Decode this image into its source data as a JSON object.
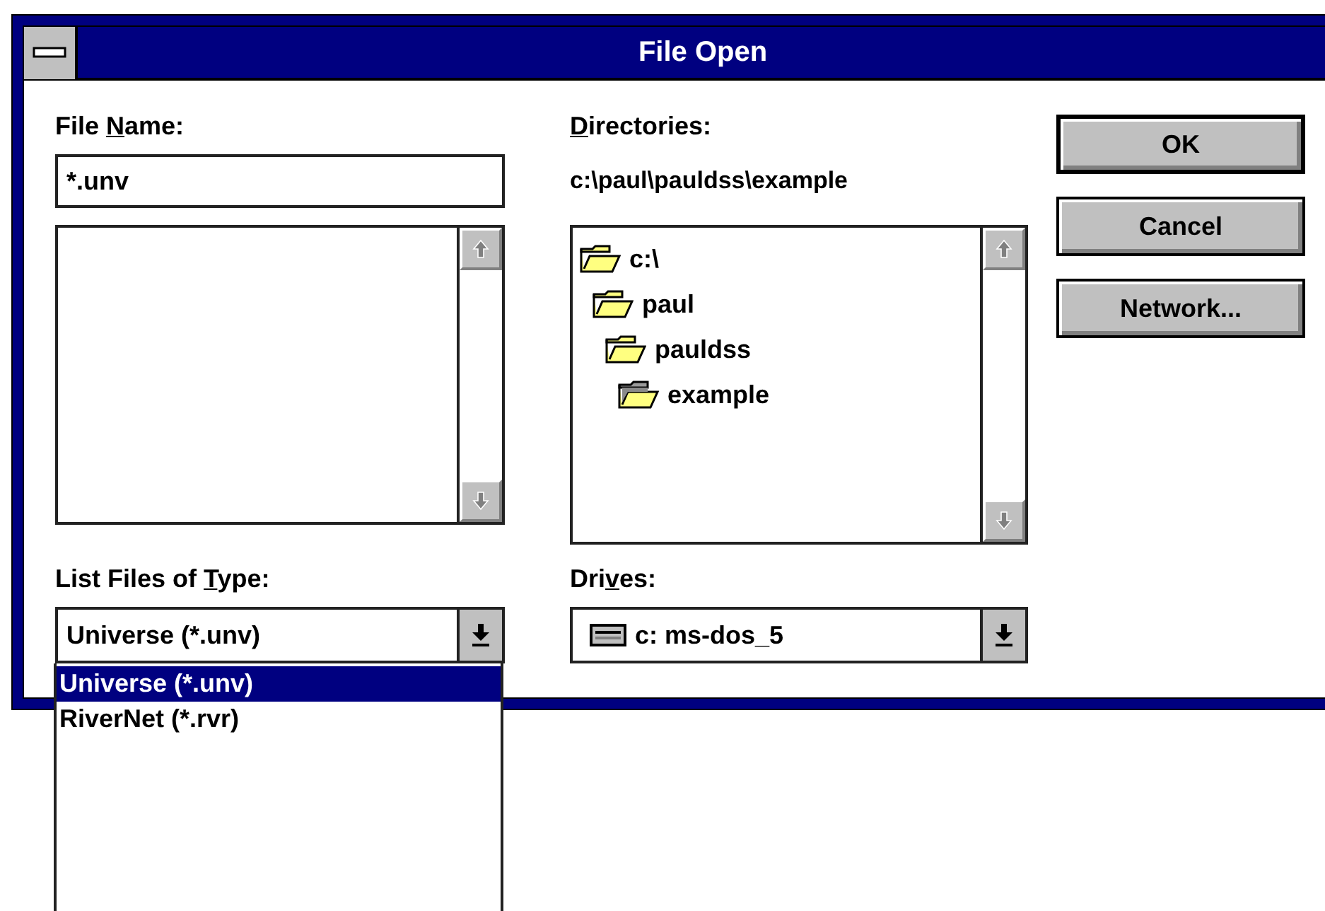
{
  "window": {
    "title": "File Open"
  },
  "file_name": {
    "label": [
      {
        "text": "File ",
        "underline": false
      },
      {
        "text": "N",
        "underline": true
      },
      {
        "text": "ame:",
        "underline": false
      }
    ],
    "value": "*.unv"
  },
  "type_filter": {
    "label": [
      {
        "text": "List Files of ",
        "underline": false
      },
      {
        "text": "T",
        "underline": true
      },
      {
        "text": "ype:",
        "underline": false
      }
    ],
    "value": "Universe (*.unv)",
    "expanded": true,
    "options": [
      {
        "label": "Universe (*.unv)",
        "selected": true
      },
      {
        "label": "RiverNet (*.rvr)",
        "selected": false
      }
    ]
  },
  "directories": {
    "label": [
      {
        "text": "D",
        "underline": true
      },
      {
        "text": "irectories:",
        "underline": false
      }
    ],
    "path": "c:\\paul\\pauldss\\example",
    "tree": [
      {
        "name": "c:\\",
        "current": false,
        "children": [
          {
            "name": "paul",
            "current": false,
            "children": [
              {
                "name": "pauldss",
                "current": false,
                "children": [
                  {
                    "name": "example",
                    "current": true
                  }
                ]
              }
            ]
          }
        ]
      }
    ]
  },
  "drives": {
    "label": [
      {
        "text": "Dri",
        "underline": false
      },
      {
        "text": "v",
        "underline": true
      },
      {
        "text": "es:",
        "underline": false
      }
    ],
    "value": "c: ms-dos_5"
  },
  "buttons": [
    {
      "label": "OK",
      "default": true
    },
    {
      "label": "Cancel",
      "default": false
    },
    {
      "label": "Network...",
      "default": false
    }
  ]
}
